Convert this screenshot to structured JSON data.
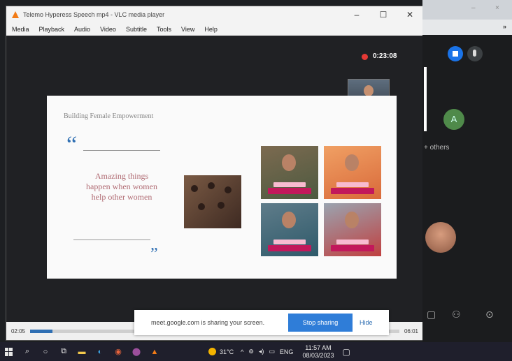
{
  "vlc": {
    "title": "Telemo Hyperess Speech mp4 - VLC media player",
    "menu": [
      "Media",
      "Playback",
      "Audio",
      "Video",
      "Subtitle",
      "Tools",
      "View",
      "Help"
    ],
    "window_controls": {
      "minimize": "–",
      "maximize": "☐",
      "close": "✕"
    },
    "seek": {
      "elapsed": "02:05",
      "total": "06:01",
      "progress_fraction": 0.06
    }
  },
  "meeting": {
    "recording_time": "0:23:08",
    "participants_label": "+ others",
    "avatar_letter": "A"
  },
  "slide": {
    "title": "Building Female Empowerment",
    "quote": "Amazing things happen when women help other women",
    "quote_meta": "",
    "open_quote": "“",
    "close_quote": "”"
  },
  "share_bar": {
    "message": "meet.google.com is sharing your screen.",
    "stop_label": "Stop sharing",
    "hide_label": "Hide"
  },
  "taskbar": {
    "weather_temp": "31°C",
    "language": "ENG",
    "time": "11:57 AM",
    "date": "08/03/2023",
    "strip_label": "»"
  },
  "icons": {
    "search": "⌕",
    "cortana": "○",
    "taskview": "⧉",
    "files": "▬",
    "edge": "◐",
    "chrome": "◉",
    "app": "⬤",
    "vlc": "▲",
    "up_arrow": "^",
    "volume": "◂)",
    "network": "⊚",
    "battery": "▭",
    "notification": "▢",
    "bottom1": "▢",
    "bottom2": "⚇",
    "bottom3": "⊙"
  }
}
